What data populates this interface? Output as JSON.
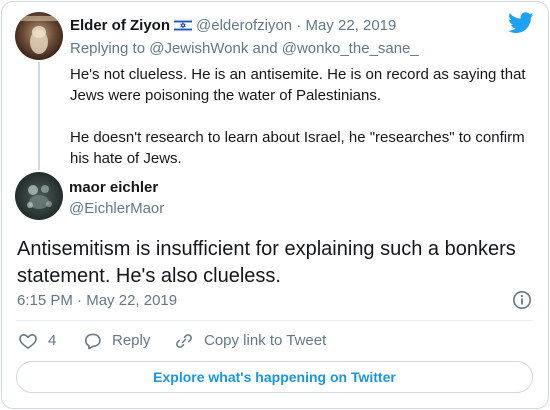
{
  "colors": {
    "accent": "#1da1f2",
    "link": "#1b95e0",
    "muted": "#657786",
    "text": "#14171a",
    "border": "#cfd9de"
  },
  "brand": {
    "icon": "twitter-bird-icon"
  },
  "parent_tweet": {
    "name": "Elder of Ziyon",
    "flag_icon": "israel-flag-icon",
    "handle": "@elderofziyon",
    "separator": "·",
    "date": "May 22, 2019",
    "replying_prefix": "Replying to",
    "reply_to_1": "@JewishWonk",
    "reply_and": "and",
    "reply_to_2": "@wonko_the_sane_",
    "paragraphs": [
      "He's not clueless. He is an antisemite. He is on record as saying that Jews were poisoning the water of Palestinians.",
      "He doesn't research to learn about Israel, he \"researches\" to confirm his hate of Jews."
    ]
  },
  "main_tweet": {
    "name": "maor eichler",
    "handle": "@EichlerMaor",
    "text": "Antisemitism is insufficient for explaining such a bonkers statement. He's also clueless.",
    "time": "6:15 PM",
    "separator": "·",
    "date": "May 22, 2019",
    "info_icon": "info-icon"
  },
  "actions": {
    "like_icon": "heart-icon",
    "like_count": "4",
    "reply_icon": "reply-bubble-icon",
    "reply_label": "Reply",
    "copy_icon": "link-icon",
    "copy_label": "Copy link to Tweet"
  },
  "explore": {
    "label": "Explore what's happening on Twitter"
  }
}
